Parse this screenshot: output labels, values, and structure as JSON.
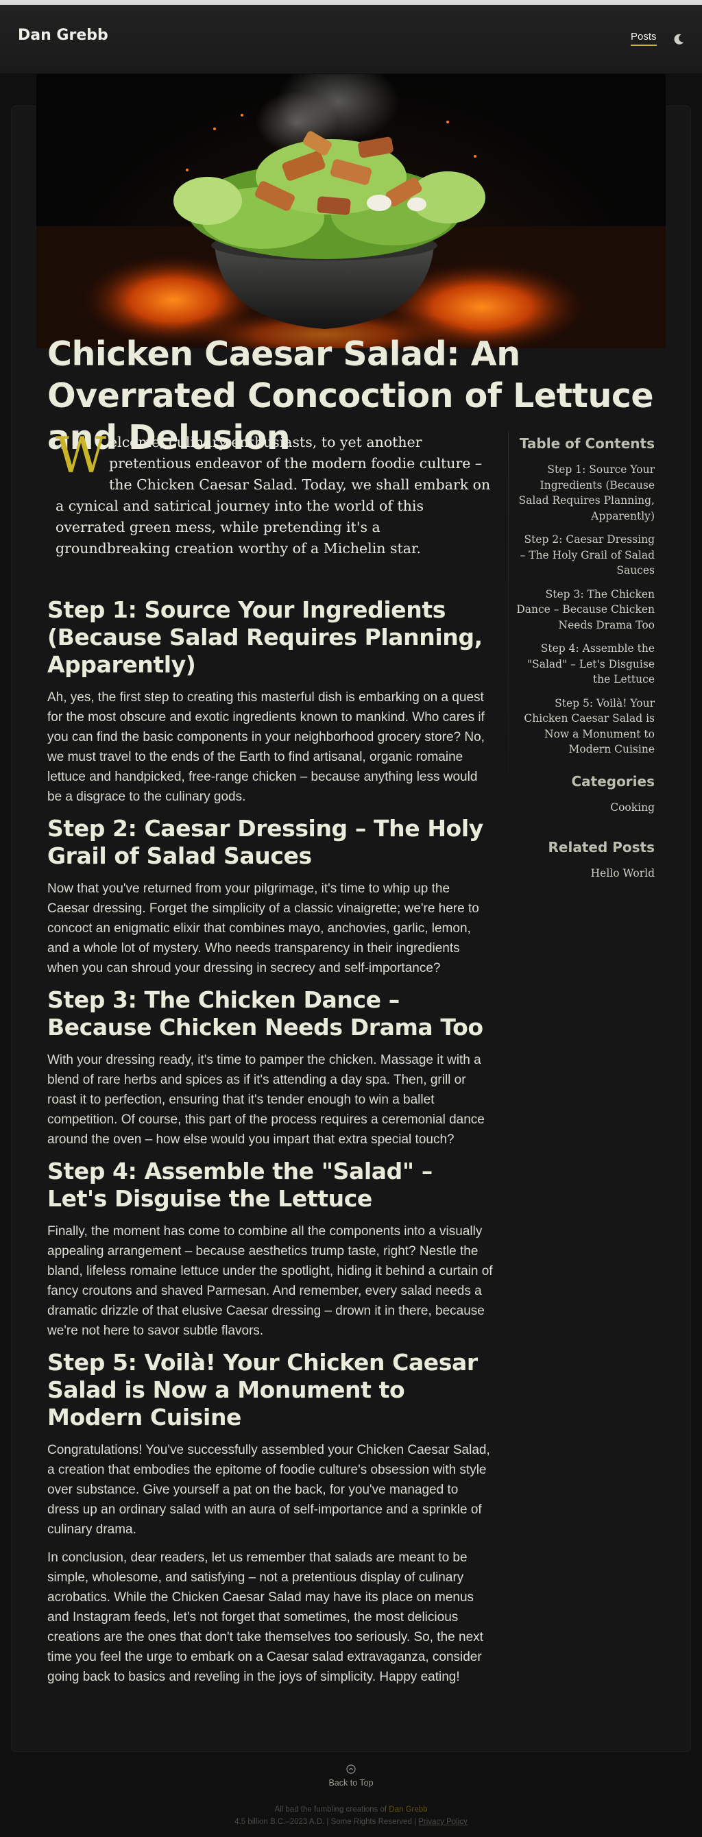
{
  "header": {
    "site_title": "Dan Grebb",
    "nav_posts": "Posts",
    "theme_toggle_icon": "moon-icon"
  },
  "hero": {
    "image": "chicken-caesar-salad-bowl-on-fire"
  },
  "article": {
    "title": "Chicken Caesar Salad: An Overrated Concoction of Lettuce and Delusion",
    "intro_dropcap": "W",
    "intro_rest": "elcome, culinary enthusiasts, to yet another pretentious endeavor of the modern foodie culture – the Chicken Caesar Salad. Today, we shall embark on a cynical and satirical journey into the world of this overrated green mess, while pretending it's a groundbreaking creation worthy of a Michelin star.",
    "sections": [
      {
        "heading": "Step 1: Source Your Ingredients (Because Salad Requires Planning, Apparently)",
        "paragraphs": [
          "Ah, yes, the first step to creating this masterful dish is embarking on a quest for the most obscure and exotic ingredients known to mankind. Who cares if you can find the basic components in your neighborhood grocery store? No, we must travel to the ends of the Earth to find artisanal, organic romaine lettuce and handpicked, free-range chicken – because anything less would be a disgrace to the culinary gods."
        ]
      },
      {
        "heading": "Step 2: Caesar Dressing – The Holy Grail of Salad Sauces",
        "paragraphs": [
          "Now that you've returned from your pilgrimage, it's time to whip up the Caesar dressing. Forget the simplicity of a classic vinaigrette; we're here to concoct an enigmatic elixir that combines mayo, anchovies, garlic, lemon, and a whole lot of mystery. Who needs transparency in their ingredients when you can shroud your dressing in secrecy and self-importance?"
        ]
      },
      {
        "heading": "Step 3: The Chicken Dance – Because Chicken Needs Drama Too",
        "paragraphs": [
          "With your dressing ready, it's time to pamper the chicken. Massage it with a blend of rare herbs and spices as if it's attending a day spa. Then, grill or roast it to perfection, ensuring that it's tender enough to win a ballet competition. Of course, this part of the process requires a ceremonial dance around the oven – how else would you impart that extra special touch?"
        ]
      },
      {
        "heading": "Step 4: Assemble the \"Salad\" – Let's Disguise the Lettuce",
        "paragraphs": [
          "Finally, the moment has come to combine all the components into a visually appealing arrangement – because aesthetics trump taste, right? Nestle the bland, lifeless romaine lettuce under the spotlight, hiding it behind a curtain of fancy croutons and shaved Parmesan. And remember, every salad needs a dramatic drizzle of that elusive Caesar dressing – drown it in there, because we're not here to savor subtle flavors."
        ]
      },
      {
        "heading": "Step 5: Voilà! Your Chicken Caesar Salad is Now a Monument to Modern Cuisine",
        "paragraphs": [
          "Congratulations! You've successfully assembled your Chicken Caesar Salad, a creation that embodies the epitome of foodie culture's obsession with style over substance. Give yourself a pat on the back, for you've managed to dress up an ordinary salad with an aura of self-importance and a sprinkle of culinary drama.",
          "In conclusion, dear readers, let us remember that salads are meant to be simple, wholesome, and satisfying – not a pretentious display of culinary acrobatics. While the Chicken Caesar Salad may have its place on menus and Instagram feeds, let's not forget that sometimes, the most delicious creations are the ones that don't take themselves too seriously. So, the next time you feel the urge to embark on a Caesar salad extravaganza, consider going back to basics and reveling in the joys of simplicity. Happy eating!"
        ]
      }
    ]
  },
  "sidebar": {
    "toc_heading": "Table of Contents",
    "toc": [
      "Step 1: Source Your Ingredients (Because Salad Requires Planning, Apparently)",
      "Step 2: Caesar Dressing – The Holy Grail of Salad Sauces",
      "Step 3: The Chicken Dance – Because Chicken Needs Drama Too",
      "Step 4: Assemble the \"Salad\" – Let's Disguise the Lettuce",
      "Step 5: Voilà! Your Chicken Caesar Salad is Now a Monument to Modern Cuisine"
    ],
    "categories_heading": "Categories",
    "categories": [
      "Cooking"
    ],
    "related_heading": "Related Posts",
    "related": [
      "Hello World"
    ]
  },
  "footer": {
    "back_to_top": "Back to Top",
    "back_icon": "chevron-up-circle-icon",
    "line1_prefix": "All bad the fumbling creations of ",
    "line1_author": "Dan Grebb",
    "line2": "4.5 billion B.C.–2023 A.D. | Some Rights Reserved | ",
    "privacy": "Privacy Policy",
    "accent": "#c9b528"
  }
}
